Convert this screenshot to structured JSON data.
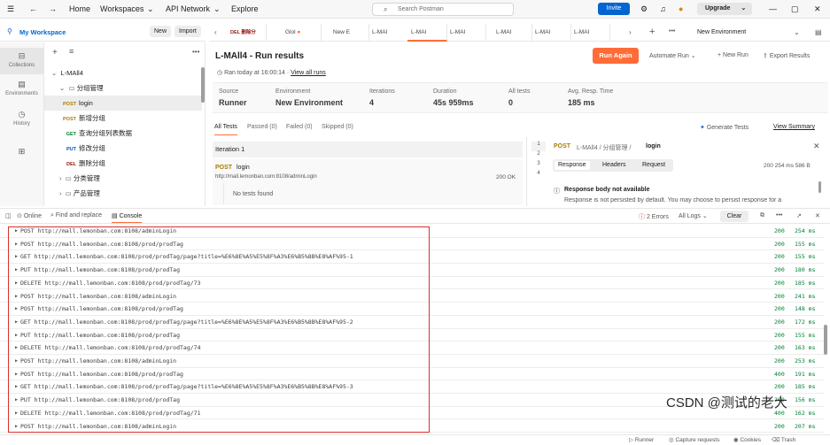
{
  "topbar": {
    "home": "Home",
    "workspaces": "Workspaces",
    "api_network": "API Network",
    "explore": "Explore",
    "search_placeholder": "Search Postman",
    "invite": "Invite",
    "upgrade": "Upgrade"
  },
  "workspace": {
    "name": "My Workspace",
    "new": "New",
    "import": "Import"
  },
  "rail": [
    "Collections",
    "Environments",
    "History"
  ],
  "sidebar": {
    "collection": "L-MAll4",
    "folder_open": "分组管理",
    "requests": [
      {
        "method": "POST",
        "label": "login"
      },
      {
        "method": "POST",
        "label": "新增分组"
      },
      {
        "method": "GET",
        "label": "查询分组列表数据"
      },
      {
        "method": "PUT",
        "label": "修改分组"
      },
      {
        "method": "DEL",
        "label": "删除分组"
      }
    ],
    "folder2": "分类管理",
    "folder3": "产品管理"
  },
  "tabs": {
    "items": [
      "DEL 删除分",
      "Glol",
      "New E",
      "L-MAI",
      "L-MAI",
      "L-MAI",
      "L-MAI",
      "L-MAI",
      "L-MAI"
    ],
    "environment": "New Environment"
  },
  "runner": {
    "title": "L-MAll4 - Run results",
    "run_again": "Run Again",
    "automate": "Automate Run",
    "new_run": "New Run",
    "export": "Export Results",
    "ran_today": "Ran today at 16:00:14",
    "view_all": "View all runs",
    "stats": [
      {
        "label": "Source",
        "value": "Runner"
      },
      {
        "label": "Environment",
        "value": "New Environment"
      },
      {
        "label": "Iterations",
        "value": "4"
      },
      {
        "label": "Duration",
        "value": "45s 959ms"
      },
      {
        "label": "All tests",
        "value": "0"
      },
      {
        "label": "Avg. Resp. Time",
        "value": "185 ms"
      }
    ],
    "subtabs": [
      "All Tests",
      "Passed (0)",
      "Failed (0)",
      "Skipped (0)"
    ],
    "generate_tests": "Generate Tests",
    "view_summary": "View Summary",
    "iteration": "Iteration 1",
    "req_method": "POST",
    "req_name": "login",
    "req_url": "http://mall.lemonban.com:8108/adminLogin",
    "req_status": "200 OK",
    "no_tests": "No tests found"
  },
  "detail": {
    "line_numbers": [
      "1",
      "2",
      "3",
      "4"
    ],
    "breadcrumb_method": "POST",
    "breadcrumb": "L-MAll4 / 分组管理 / ",
    "breadcrumb_leaf": "login",
    "tabs": [
      "Response",
      "Headers",
      "Request"
    ],
    "meta": "200  254 ms  586 B",
    "notice_title": "Response body not available",
    "notice_text": "Response is not persisted by default. You may choose to persist response for a"
  },
  "console_header": {
    "online": "Online",
    "find_replace": "Find and replace",
    "console": "Console",
    "errors": "2 Errors",
    "all_logs": "All Logs",
    "clear": "Clear"
  },
  "console_rows": [
    {
      "text": "POST http://mall.lemonban.com:8108/adminLogin",
      "code": "200",
      "time": "254 ms"
    },
    {
      "text": "POST http://mall.lemonban.com:8108/prod/prodTag",
      "code": "200",
      "time": "155 ms"
    },
    {
      "text": "GET http://mall.lemonban.com:8108/prod/prodTag/page?title=%E6%8E%A5%E5%8F%A3%E6%B5%8B%E8%AF%95-1",
      "code": "200",
      "time": "155 ms"
    },
    {
      "text": "PUT http://mall.lemonban.com:8108/prod/prodTag",
      "code": "200",
      "time": "180 ms"
    },
    {
      "text": "DELETE http://mall.lemonban.com:8108/prod/prodTag/73",
      "code": "200",
      "time": "185 ms"
    },
    {
      "text": "POST http://mall.lemonban.com:8108/adminLogin",
      "code": "200",
      "time": "241 ms"
    },
    {
      "text": "POST http://mall.lemonban.com:8108/prod/prodTag",
      "code": "200",
      "time": "148 ms"
    },
    {
      "text": "GET http://mall.lemonban.com:8108/prod/prodTag/page?title=%E6%8E%A5%E5%8F%A3%E6%B5%8B%E8%AF%95-2",
      "code": "200",
      "time": "172 ms"
    },
    {
      "text": "PUT http://mall.lemonban.com:8108/prod/prodTag",
      "code": "200",
      "time": "155 ms"
    },
    {
      "text": "DELETE http://mall.lemonban.com:8108/prod/prodTag/74",
      "code": "200",
      "time": "163 ms"
    },
    {
      "text": "POST http://mall.lemonban.com:8108/adminLogin",
      "code": "200",
      "time": "253 ms"
    },
    {
      "text": "POST http://mall.lemonban.com:8108/prod/prodTag",
      "code": "400",
      "time": "191 ms"
    },
    {
      "text": "GET http://mall.lemonban.com:8108/prod/prodTag/page?title=%E6%8E%A5%E5%8F%A3%E6%B5%8B%E8%AF%95-3",
      "code": "200",
      "time": "185 ms"
    },
    {
      "text": "PUT http://mall.lemonban.com:8108/prod/prodTag",
      "code": "200",
      "time": "156 ms"
    },
    {
      "text": "DELETE http://mall.lemonban.com:8108/prod/prodTag/71",
      "code": "400",
      "time": "162 ms"
    },
    {
      "text": "POST http://mall.lemonban.com:8108/adminLogin",
      "code": "200",
      "time": "207 ms"
    }
  ],
  "statusbar": {
    "runner": "Runner",
    "capture": "Capture requests",
    "cookies": "Cookies",
    "trash": "Trash"
  },
  "watermark": "CSDN @测试的老大",
  "colors": {
    "accent": "#ff6c37",
    "invite": "#0265d2",
    "ok": "#007f31",
    "highlight": "#d9302a"
  }
}
